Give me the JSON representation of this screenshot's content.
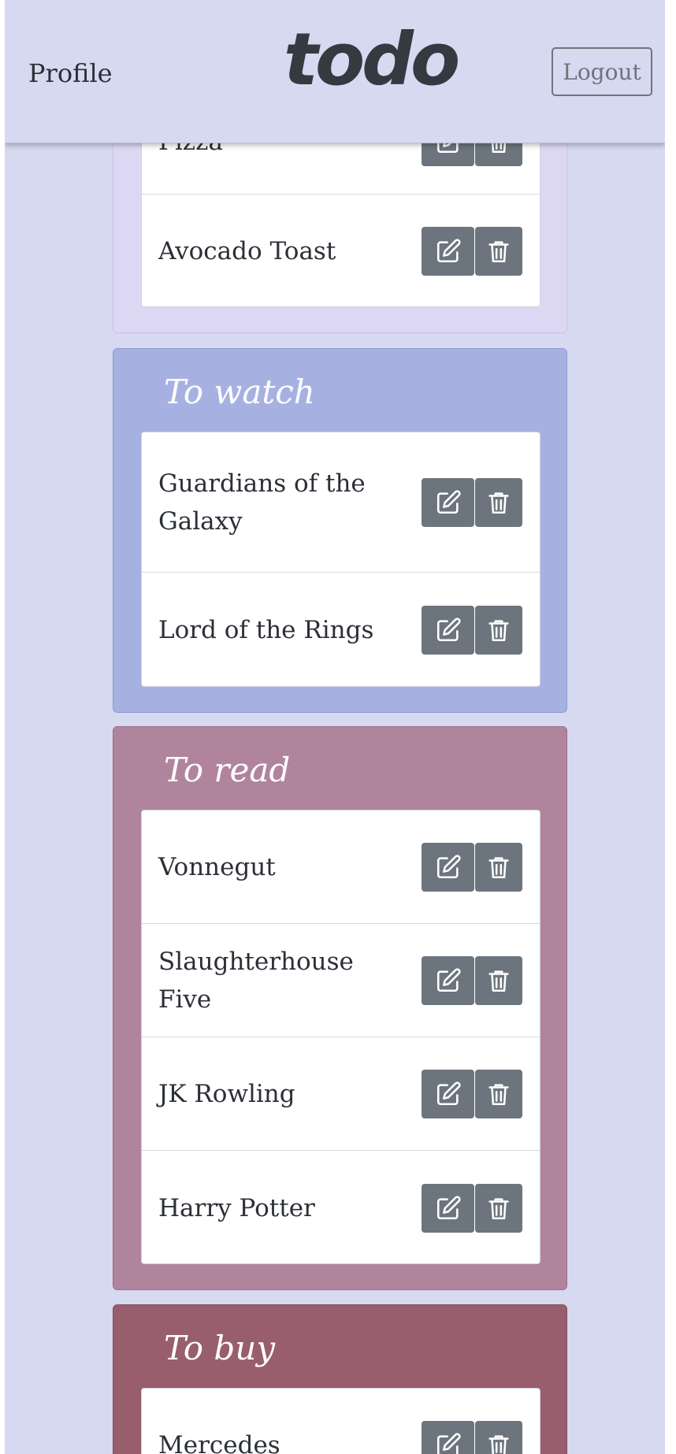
{
  "header": {
    "profile_label": "Profile",
    "logo_text": "todo",
    "logout_label": "Logout"
  },
  "colors": {
    "page_bg": "#d6d9f0",
    "to_eat": "#dcd8f3",
    "to_watch": "#a7b1e1",
    "to_read": "#b1849d",
    "to_buy": "#985e6d",
    "button": "#6c757d"
  },
  "lists": [
    {
      "title": "",
      "items": [
        {
          "label": "Pizza"
        },
        {
          "label": "Avocado Toast"
        }
      ]
    },
    {
      "title": "To watch",
      "items": [
        {
          "label": "Guardians of the Galaxy"
        },
        {
          "label": "Lord of the Rings"
        }
      ]
    },
    {
      "title": "To read",
      "items": [
        {
          "label": "Vonnegut"
        },
        {
          "label": "Slaughterhouse Five"
        },
        {
          "label": "JK Rowling"
        },
        {
          "label": "Harry Potter"
        }
      ]
    },
    {
      "title": "To buy",
      "items": [
        {
          "label": "Mercedes"
        }
      ]
    }
  ],
  "icons": {
    "edit": "edit-icon",
    "delete": "trash-icon"
  }
}
